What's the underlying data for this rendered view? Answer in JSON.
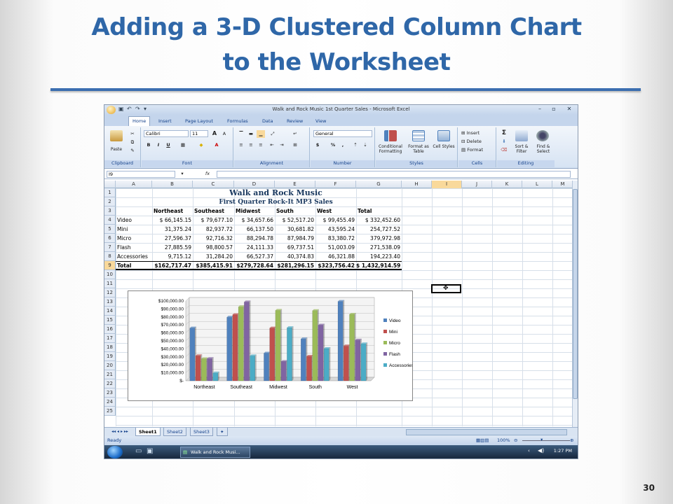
{
  "slide": {
    "title_line1": "Adding a 3-D Clustered Column Chart",
    "title_line2": "to the Worksheet",
    "page_number": "30",
    "accent_color": "#2f67a8"
  },
  "excel": {
    "window_title": "Walk and Rock Music 1st Quarter Sales - Microsoft Excel",
    "tabs": [
      "Home",
      "Insert",
      "Page Layout",
      "Formulas",
      "Data",
      "Review",
      "View"
    ],
    "active_tab": "Home",
    "ribbon": {
      "clipboard": {
        "label": "Clipboard",
        "paste": "Paste"
      },
      "font": {
        "label": "Font",
        "font_name": "Calibri",
        "font_size": "11",
        "bold": "B",
        "italic": "I",
        "underline": "U",
        "grow": "A",
        "shrink": "A"
      },
      "alignment": {
        "label": "Alignment"
      },
      "number": {
        "label": "Number",
        "format": "General",
        "currency": "$",
        "percent": "%",
        "comma": ","
      },
      "styles": {
        "label": "Styles",
        "conditional": "Conditional Formatting",
        "format_table": "Format as Table",
        "cell_styles": "Cell Styles"
      },
      "cells": {
        "label": "Cells",
        "insert": "Insert",
        "delete": "Delete",
        "format": "Format"
      },
      "editing": {
        "label": "Editing",
        "sum": "Σ",
        "sort": "Sort & Filter",
        "find": "Find & Select"
      }
    },
    "name_box": "I9",
    "fx": "fx",
    "columns": [
      "A",
      "B",
      "C",
      "D",
      "E",
      "F",
      "G",
      "H",
      "I",
      "J",
      "K",
      "L",
      "M"
    ],
    "selected_column": "I",
    "selected_row": "9",
    "rows": [
      "1",
      "2",
      "3",
      "4",
      "5",
      "6",
      "7",
      "8",
      "9",
      "10",
      "11",
      "12",
      "13",
      "14",
      "15",
      "16",
      "17",
      "18",
      "19",
      "20",
      "21",
      "22",
      "23",
      "24",
      "25"
    ],
    "sheet_title": "Walk and Rock Music",
    "sheet_subtitle": "First Quarter Rock-It MP3 Sales",
    "table_headers": [
      "Northeast",
      "Southeast",
      "Midwest",
      "South",
      "West",
      "Total"
    ],
    "table_rows": [
      {
        "label": "Video",
        "values": [
          "$ 66,145.15",
          "$ 79,677.10",
          "$ 34,657.66",
          "$ 52,517.20",
          "$ 99,455.49",
          "$ 332,452.60"
        ]
      },
      {
        "label": "Mini",
        "values": [
          "31,375.24",
          "82,937.72",
          "66,137.50",
          "30,681.82",
          "43,595.24",
          "254,727.52"
        ]
      },
      {
        "label": "Micro",
        "values": [
          "27,596.37",
          "92,716.32",
          "88,294.78",
          "87,984.79",
          "83,380.72",
          "379,972.98"
        ]
      },
      {
        "label": "Flash",
        "values": [
          "27,885.59",
          "98,800.57",
          "24,111.33",
          "69,737.51",
          "51,003.09",
          "271,538.09"
        ]
      },
      {
        "label": "Accessories",
        "values": [
          "9,715.12",
          "31,284.20",
          "66,527.37",
          "40,374.83",
          "46,321.88",
          "194,223.40"
        ]
      }
    ],
    "total_row": {
      "label": "Total",
      "values": [
        "$162,717.47",
        "$385,415.91",
        "$279,728.64",
        "$281,296.15",
        "$323,756.42",
        "$ 1,432,914.59"
      ]
    },
    "sheet_tabs": [
      "Sheet1",
      "Sheet2",
      "Sheet3"
    ],
    "status_ready": "Ready",
    "zoom": "100%",
    "taskbar_item": "Walk and Rock Musi...",
    "clock": "1:27 PM"
  },
  "chart_data": {
    "type": "bar",
    "categories": [
      "Northeast",
      "Southeast",
      "Midwest",
      "South",
      "West"
    ],
    "series": [
      {
        "name": "Video",
        "color": "#4f81bd",
        "values": [
          66145.15,
          79677.1,
          34657.66,
          52517.2,
          99455.49
        ]
      },
      {
        "name": "Mini",
        "color": "#c0504d",
        "values": [
          31375.24,
          82937.72,
          66137.5,
          30681.82,
          43595.24
        ]
      },
      {
        "name": "Micro",
        "color": "#9bbb59",
        "values": [
          27596.37,
          92716.32,
          88294.78,
          87984.79,
          83380.72
        ]
      },
      {
        "name": "Flash",
        "color": "#8064a2",
        "values": [
          27885.59,
          98800.57,
          24111.33,
          69737.51,
          51003.09
        ]
      },
      {
        "name": "Accessories",
        "color": "#4bacc6",
        "values": [
          9715.12,
          31284.2,
          66527.37,
          40374.83,
          46321.88
        ]
      }
    ],
    "y_ticks": [
      "$100,000.00",
      "$90,000.00",
      "$80,000.00",
      "$70,000.00",
      "$60,000.00",
      "$50,000.00",
      "$40,000.00",
      "$30,000.00",
      "$20,000.00",
      "$10,000.00",
      "$-"
    ],
    "ylim": [
      0,
      100000
    ],
    "legend_position": "right",
    "grid": true
  }
}
